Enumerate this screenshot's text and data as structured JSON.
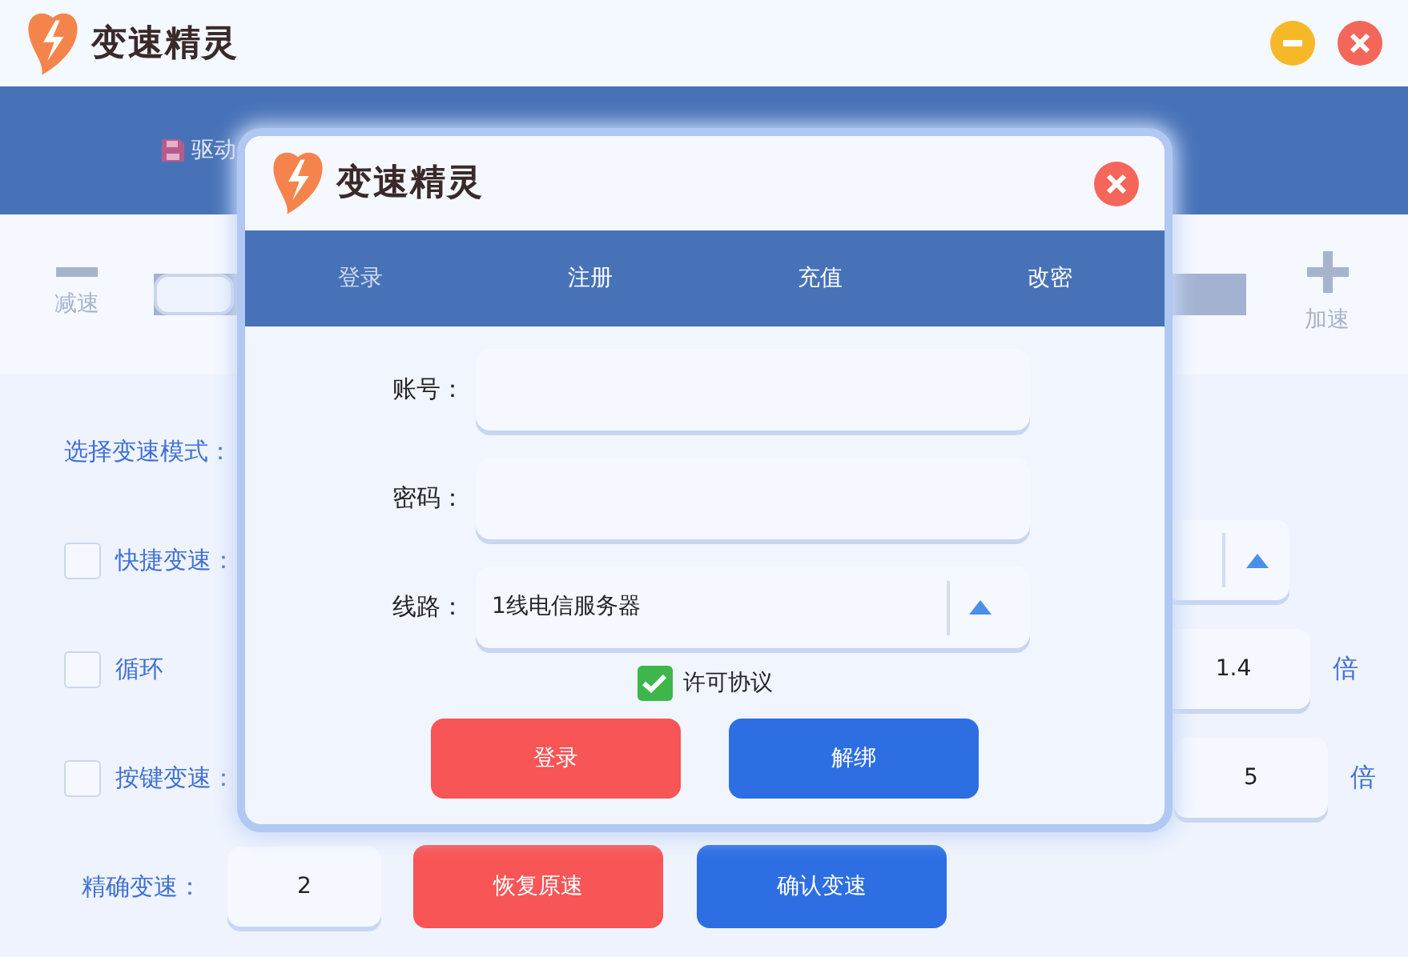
{
  "app": {
    "title": "变速精灵",
    "window_controls": [
      {
        "kind": "minimize"
      },
      {
        "kind": "close"
      }
    ]
  },
  "nav": {
    "items": [
      {
        "label": "驱动"
      }
    ]
  },
  "speed": {
    "decrease_label": "减速",
    "increase_label": "加速",
    "level": 0
  },
  "mode": {
    "label": "选择变速模式："
  },
  "options": [
    {
      "label": "快捷变速：",
      "checked": false,
      "kind": "dropdown"
    },
    {
      "label": "循环",
      "checked": false,
      "kind": "input",
      "value": "1.4",
      "unit": "倍"
    },
    {
      "label": "按键变速：",
      "checked": false,
      "kind": "input",
      "value": "5",
      "unit": "倍"
    }
  ],
  "precise": {
    "label": "精确变速：",
    "value": "2",
    "buttons": [
      {
        "label": "恢复原速",
        "kind": "danger"
      },
      {
        "label": "确认变速",
        "kind": "primary"
      }
    ]
  },
  "dialog": {
    "title": "变速精灵",
    "tabs": [
      {
        "label": "登录",
        "selected": true
      },
      {
        "label": "注册",
        "selected": false
      },
      {
        "label": "充值",
        "selected": false
      },
      {
        "label": "改密",
        "selected": false
      }
    ],
    "fields": [
      {
        "label": "账号：",
        "kind": "text"
      },
      {
        "label": "密码：",
        "kind": "password"
      },
      {
        "label": "线路：",
        "kind": "select",
        "value": "1线电信服务器"
      }
    ],
    "agree": {
      "label": "许可协议",
      "checked": true
    },
    "buttons": [
      {
        "label": "登录",
        "kind": "danger"
      },
      {
        "label": "解绑",
        "kind": "primary"
      }
    ]
  }
}
